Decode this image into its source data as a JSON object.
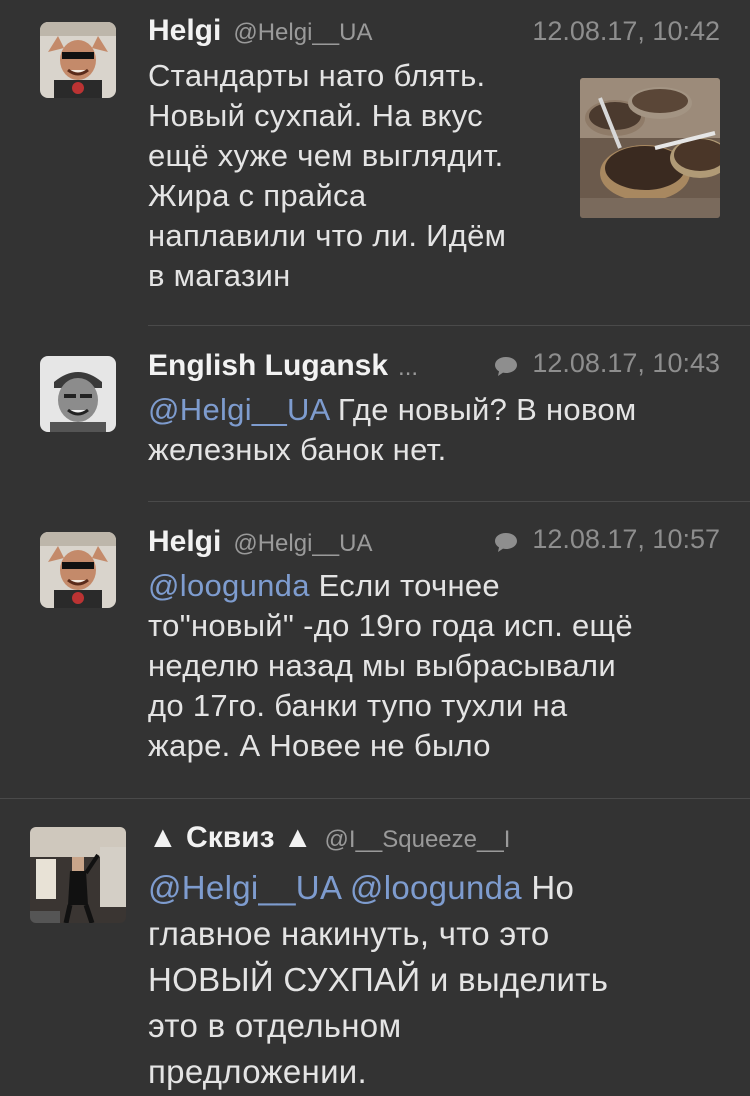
{
  "tweets": [
    {
      "name": "Helgi",
      "handle": "@Helgi__UA",
      "time": "12.08.17, 10:42",
      "lines": [
        "Стандарты нато блять.",
        "Новый сухпай. На вкус",
        "ещё хуже чем выглядит.",
        "Жира с прайса",
        "наплавили что ли. Идём",
        "в магазин"
      ],
      "has_reply_icon": false,
      "has_media": true
    },
    {
      "name": "English Lugansk",
      "name_ellipsis": "...",
      "time": "12.08.17, 10:43",
      "mention": "@Helgi__UA",
      "line1_rest": " Где новый? В новом",
      "lines_rest": [
        "железных банок нет."
      ],
      "has_reply_icon": true
    },
    {
      "name": "Helgi",
      "handle": "@Helgi__UA",
      "time": "12.08.17, 10:57",
      "mention": "@loogunda",
      "line1_rest": " Если точнее",
      "lines_rest": [
        "то\"новый\" -до 19го года исп. ещё",
        "неделю назад мы выбрасывали",
        "до 17го. банки тупо тухли на",
        "жаре. А Новее не было"
      ],
      "has_reply_icon": true
    },
    {
      "name": "▲ Сквиз ▲",
      "handle": "@I__Squeeze__I",
      "mention1": "@Helgi__UA",
      "mention2": "@loogunda",
      "line1_rest": " Но",
      "lines_rest": [
        "главное накинуть, что это",
        "НОВЫЙ СУХПАЙ и выделить",
        "это в отдельном",
        "предложении."
      ]
    }
  ],
  "colors": {
    "background": "#333333",
    "mention": "#7e9ccf",
    "meta": "#8e8e8e",
    "divider": "#4a4a4a"
  },
  "icons": {
    "reply": "speech-bubble-icon"
  }
}
